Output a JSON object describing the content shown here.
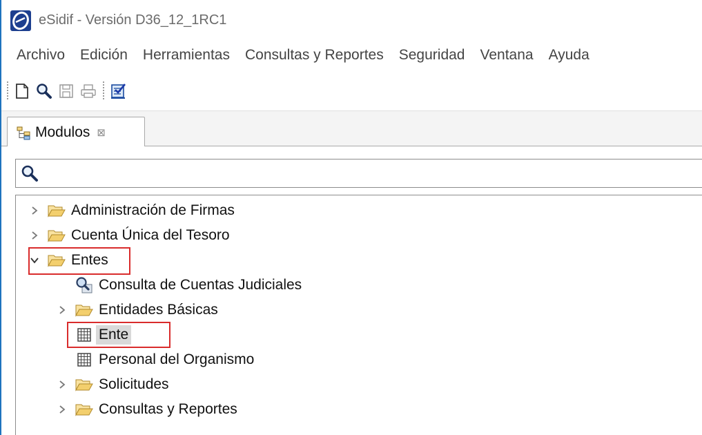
{
  "window": {
    "title": "eSidif - Versión D36_12_1RC1"
  },
  "menu": [
    "Archivo",
    "Edición",
    "Herramientas",
    "Consultas y Reportes",
    "Seguridad",
    "Ventana",
    "Ayuda"
  ],
  "toolbar": {
    "buttons": [
      "new-document-icon",
      "search-icon",
      "save-icon",
      "print-icon",
      "checklist-icon"
    ]
  },
  "view": {
    "tab_label": "Modulos",
    "tab_close": "⊠"
  },
  "search": {
    "value": "",
    "placeholder": ""
  },
  "tree": [
    {
      "label": "Administración de Firmas",
      "expanded": false,
      "type": "folder",
      "level": 0
    },
    {
      "label": "Cuenta Única del Tesoro",
      "expanded": false,
      "type": "folder",
      "level": 0
    },
    {
      "label": "Entes",
      "expanded": true,
      "type": "folder",
      "level": 0,
      "highlighted": true
    },
    {
      "label": "Consulta de Cuentas Judiciales",
      "type": "query",
      "level": 1
    },
    {
      "label": "Entidades Básicas",
      "expanded": false,
      "type": "folder",
      "level": 1
    },
    {
      "label": "Ente",
      "type": "table",
      "level": 1,
      "selected": true,
      "highlighted": true
    },
    {
      "label": "Personal del Organismo",
      "type": "table",
      "level": 1
    },
    {
      "label": "Solicitudes",
      "expanded": false,
      "type": "folder",
      "level": 1
    },
    {
      "label": "Consultas y Reportes",
      "expanded": false,
      "type": "folder",
      "level": 1
    }
  ],
  "colors": {
    "highlight": "#d92b2b",
    "folder": "#f0c35a",
    "selection": "#d9d9d9"
  }
}
